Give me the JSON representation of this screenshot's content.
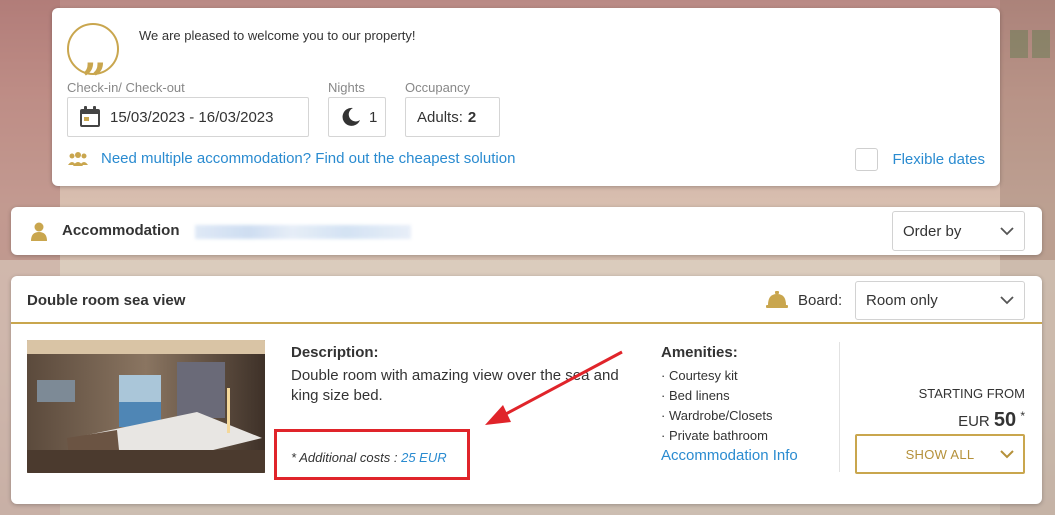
{
  "search": {
    "welcome": "We are pleased to welcome you to our property!",
    "checkin_label": "Check-in/ Check-out",
    "dates": "15/03/2023 - 16/03/2023",
    "nights_label": "Nights",
    "nights": "1",
    "occupancy_label": "Occupancy",
    "adults_label": "Adults:",
    "adults": "2",
    "multi_link": "Need multiple accommodation? Find out the cheapest solution",
    "flexible": "Flexible dates"
  },
  "accommodation_bar": {
    "label": "Accommodation",
    "order_by": "Order by"
  },
  "room": {
    "title": "Double room sea view",
    "board_label": "Board:",
    "board_value": "Room only",
    "description_title": "Description:",
    "description": "Double room with amazing view over the sea and king size bed.",
    "additional_costs_label": "* Additional costs :",
    "additional_costs_value": "25 EUR",
    "amenities_title": "Amenities:",
    "amenities": [
      "Courtesy kit",
      "Bed linens",
      "Wardrobe/Closets",
      "Private bathroom"
    ],
    "accommodation_info": "Accommodation Info",
    "starting_from": "STARTING FROM",
    "currency": "EUR",
    "price": "50",
    "price_mark": "*",
    "show_all": "SHOW ALL"
  },
  "colors": {
    "gold": "#c9a64e",
    "link": "#2a8bd0",
    "annotation": "#e0242a"
  }
}
